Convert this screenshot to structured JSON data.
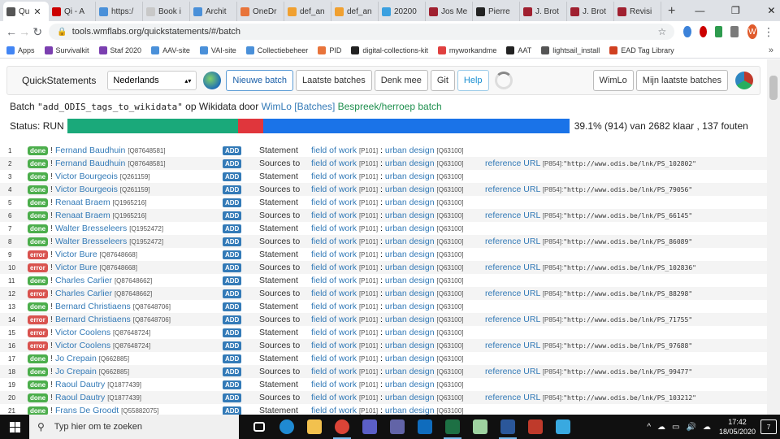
{
  "browser": {
    "tabs": [
      {
        "label": "Qu",
        "color": "#555555",
        "active": true
      },
      {
        "label": "Qi - A",
        "color": "#cc0000"
      },
      {
        "label": "https:/",
        "color": "#4a90d9"
      },
      {
        "label": "Book i",
        "color": "#c8c8c8"
      },
      {
        "label": "Archit",
        "color": "#4a90d9"
      },
      {
        "label": "OneDr",
        "color": "#e8743b"
      },
      {
        "label": "def_an",
        "color": "#f0a030"
      },
      {
        "label": "def_an",
        "color": "#f0a030"
      },
      {
        "label": "20200",
        "color": "#3aa0e0"
      },
      {
        "label": "Jos Me",
        "color": "#a02030"
      },
      {
        "label": "Pierre",
        "color": "#222222"
      },
      {
        "label": "J. Brot",
        "color": "#a02030"
      },
      {
        "label": "J. Brot",
        "color": "#a02030"
      },
      {
        "label": "Revisi",
        "color": "#a02030"
      }
    ],
    "tab_close": "✕",
    "new_tab": "+",
    "window_controls": [
      "—",
      "❐",
      "✕"
    ],
    "url": "tools.wmflabs.org/quickstatements/#/batch",
    "profile_initial": "W",
    "bookmarks": [
      {
        "label": "Apps",
        "color": "#4285f4"
      },
      {
        "label": "Survivalkit",
        "color": "#7b3fb0"
      },
      {
        "label": "Staf 2020",
        "color": "#7b3fb0"
      },
      {
        "label": "AAV-site",
        "color": "#4a90d9"
      },
      {
        "label": "VAI-site",
        "color": "#4a90d9"
      },
      {
        "label": "Collectiebeheer",
        "color": "#4a90d9"
      },
      {
        "label": "PID",
        "color": "#e8743b"
      },
      {
        "label": "digital-collections-kit",
        "color": "#222222"
      },
      {
        "label": "myworkandme",
        "color": "#e04040"
      },
      {
        "label": "AAT",
        "color": "#222222"
      },
      {
        "label": "lightsail_install",
        "color": "#555555"
      },
      {
        "label": "EAD Tag Library",
        "color": "#d04020"
      }
    ],
    "bookmarks_more": "»"
  },
  "app": {
    "brand": "QuickStatements",
    "language": "Nederlands",
    "buttons": {
      "new_batch": "Nieuwe batch",
      "last_batches": "Laatste batches",
      "think_along": "Denk mee",
      "git": "Git",
      "help": "Help",
      "user": "WimLo",
      "my_batches": "Mijn laatste batches"
    }
  },
  "batch": {
    "prefix": "Batch ",
    "name": "\"add_ODIS_tags_to_wikidata\"",
    "mid": " op Wikidata door ",
    "user": "WimLo",
    "batches_link": "[Batches]",
    "discuss_link": "Bespreek/herroep batch",
    "status_label": "Status: RUN",
    "progress_text": "39.1% (914) van 2682 klaar , 137 fouten",
    "progress_segments": [
      {
        "fraction": 0.34,
        "color": "#1aa97a"
      },
      {
        "fraction": 0.051,
        "color": "#e0363c"
      },
      {
        "fraction": 0.609,
        "color": "#1a73e8"
      }
    ]
  },
  "rows": [
    {
      "n": "1",
      "status": "done",
      "item": "Fernand Baudhuin",
      "qid": "[Q87648581]",
      "cmd": "ADD",
      "type": "Statement",
      "prop": "field of work",
      "pid": "[P101]",
      "sep": " : ",
      "value": "urban design",
      "vqid": "[Q63100]",
      "ref": "",
      "refpid": "",
      "refval": ""
    },
    {
      "n": "2",
      "status": "done",
      "item": "Fernand Baudhuin",
      "qid": "[Q87648581]",
      "cmd": "ADD",
      "type": "Sources to",
      "prop": "field of work",
      "pid": "[P101]",
      "sep": " : ",
      "value": "urban design",
      "vqid": "[Q63100]",
      "ref": "reference URL",
      "refpid": "[P854]:",
      "refval": "\"http://www.odis.be/lnk/PS_102802\""
    },
    {
      "n": "3",
      "status": "done",
      "item": "Victor Bourgeois",
      "qid": "[Q261159]",
      "cmd": "ADD",
      "type": "Statement",
      "prop": "field of work",
      "pid": "[P101]",
      "sep": " : ",
      "value": "urban design",
      "vqid": "[Q63100]",
      "ref": "",
      "refpid": "",
      "refval": ""
    },
    {
      "n": "4",
      "status": "done",
      "item": "Victor Bourgeois",
      "qid": "[Q261159]",
      "cmd": "ADD",
      "type": "Sources to",
      "prop": "field of work",
      "pid": "[P101]",
      "sep": " : ",
      "value": "urban design",
      "vqid": "[Q63100]",
      "ref": "reference URL",
      "refpid": "[P854]:",
      "refval": "\"http://www.odis.be/lnk/PS_79056\""
    },
    {
      "n": "5",
      "status": "done",
      "item": "Renaat Braem",
      "qid": "[Q1965216]",
      "cmd": "ADD",
      "type": "Statement",
      "prop": "field of work",
      "pid": "[P101]",
      "sep": " : ",
      "value": "urban design",
      "vqid": "[Q63100]",
      "ref": "",
      "refpid": "",
      "refval": ""
    },
    {
      "n": "6",
      "status": "done",
      "item": "Renaat Braem",
      "qid": "[Q1965216]",
      "cmd": "ADD",
      "type": "Sources to",
      "prop": "field of work",
      "pid": "[P101]",
      "sep": " : ",
      "value": "urban design",
      "vqid": "[Q63100]",
      "ref": "reference URL",
      "refpid": "[P854]:",
      "refval": "\"http://www.odis.be/lnk/PS_66145\""
    },
    {
      "n": "7",
      "status": "done",
      "item": "Walter Bresseleers",
      "qid": "[Q1952472]",
      "cmd": "ADD",
      "type": "Statement",
      "prop": "field of work",
      "pid": "[P101]",
      "sep": " : ",
      "value": "urban design",
      "vqid": "[Q63100]",
      "ref": "",
      "refpid": "",
      "refval": ""
    },
    {
      "n": "8",
      "status": "done",
      "item": "Walter Bresseleers",
      "qid": "[Q1952472]",
      "cmd": "ADD",
      "type": "Sources to",
      "prop": "field of work",
      "pid": "[P101]",
      "sep": " : ",
      "value": "urban design",
      "vqid": "[Q63100]",
      "ref": "reference URL",
      "refpid": "[P854]:",
      "refval": "\"http://www.odis.be/lnk/PS_86089\""
    },
    {
      "n": "9",
      "status": "error",
      "item": "Victor Bure",
      "qid": "[Q87648668]",
      "cmd": "ADD",
      "type": "Statement",
      "prop": "field of work",
      "pid": "[P101]",
      "sep": " : ",
      "value": "urban design",
      "vqid": "[Q63100]",
      "ref": "",
      "refpid": "",
      "refval": ""
    },
    {
      "n": "10",
      "status": "error",
      "item": "Victor Bure",
      "qid": "[Q87648668]",
      "cmd": "ADD",
      "type": "Sources to",
      "prop": "field of work",
      "pid": "[P101]",
      "sep": " : ",
      "value": "urban design",
      "vqid": "[Q63100]",
      "ref": "reference URL",
      "refpid": "[P854]:",
      "refval": "\"http://www.odis.be/lnk/PS_102836\""
    },
    {
      "n": "11",
      "status": "done",
      "item": "Charles Carlier",
      "qid": "[Q87648662]",
      "cmd": "ADD",
      "type": "Statement",
      "prop": "field of work",
      "pid": "[P101]",
      "sep": " : ",
      "value": "urban design",
      "vqid": "[Q63100]",
      "ref": "",
      "refpid": "",
      "refval": ""
    },
    {
      "n": "12",
      "status": "error",
      "item": "Charles Carlier",
      "qid": "[Q87648662]",
      "cmd": "ADD",
      "type": "Sources to",
      "prop": "field of work",
      "pid": "[P101]",
      "sep": " : ",
      "value": "urban design",
      "vqid": "[Q63100]",
      "ref": "reference URL",
      "refpid": "[P854]:",
      "refval": "\"http://www.odis.be/lnk/PS_88298\""
    },
    {
      "n": "13",
      "status": "done",
      "item": "Bernard Christiaens",
      "qid": "[Q87648706]",
      "cmd": "ADD",
      "type": "Statement",
      "prop": "field of work",
      "pid": "[P101]",
      "sep": " : ",
      "value": "urban design",
      "vqid": "[Q63100]",
      "ref": "",
      "refpid": "",
      "refval": ""
    },
    {
      "n": "14",
      "status": "error",
      "item": "Bernard Christiaens",
      "qid": "[Q87648706]",
      "cmd": "ADD",
      "type": "Sources to",
      "prop": "field of work",
      "pid": "[P101]",
      "sep": " : ",
      "value": "urban design",
      "vqid": "[Q63100]",
      "ref": "reference URL",
      "refpid": "[P854]:",
      "refval": "\"http://www.odis.be/lnk/PS_71755\""
    },
    {
      "n": "15",
      "status": "error",
      "item": "Victor Coolens",
      "qid": "[Q87648724]",
      "cmd": "ADD",
      "type": "Statement",
      "prop": "field of work",
      "pid": "[P101]",
      "sep": " : ",
      "value": "urban design",
      "vqid": "[Q63100]",
      "ref": "",
      "refpid": "",
      "refval": ""
    },
    {
      "n": "16",
      "status": "error",
      "item": "Victor Coolens",
      "qid": "[Q87648724]",
      "cmd": "ADD",
      "type": "Sources to",
      "prop": "field of work",
      "pid": "[P101]",
      "sep": " : ",
      "value": "urban design",
      "vqid": "[Q63100]",
      "ref": "reference URL",
      "refpid": "[P854]:",
      "refval": "\"http://www.odis.be/lnk/PS_97688\""
    },
    {
      "n": "17",
      "status": "done",
      "item": "Jo Crepain",
      "qid": "[Q662885]",
      "cmd": "ADD",
      "type": "Statement",
      "prop": "field of work",
      "pid": "[P101]",
      "sep": " : ",
      "value": "urban design",
      "vqid": "[Q63100]",
      "ref": "",
      "refpid": "",
      "refval": ""
    },
    {
      "n": "18",
      "status": "done",
      "item": "Jo Crepain",
      "qid": "[Q662885]",
      "cmd": "ADD",
      "type": "Sources to",
      "prop": "field of work",
      "pid": "[P101]",
      "sep": " : ",
      "value": "urban design",
      "vqid": "[Q63100]",
      "ref": "reference URL",
      "refpid": "[P854]:",
      "refval": "\"http://www.odis.be/lnk/PS_99477\""
    },
    {
      "n": "19",
      "status": "done",
      "item": "Raoul Dautry",
      "qid": "[Q1877439]",
      "cmd": "ADD",
      "type": "Statement",
      "prop": "field of work",
      "pid": "[P101]",
      "sep": " : ",
      "value": "urban design",
      "vqid": "[Q63100]",
      "ref": "",
      "refpid": "",
      "refval": ""
    },
    {
      "n": "20",
      "status": "done",
      "item": "Raoul Dautry",
      "qid": "[Q1877439]",
      "cmd": "ADD",
      "type": "Sources to",
      "prop": "field of work",
      "pid": "[P101]",
      "sep": " : ",
      "value": "urban design",
      "vqid": "[Q63100]",
      "ref": "reference URL",
      "refpid": "[P854]:",
      "refval": "\"http://www.odis.be/lnk/PS_103212\""
    },
    {
      "n": "21",
      "status": "done",
      "item": "Frans De Groodt",
      "qid": "[Q55882075]",
      "cmd": "ADD",
      "type": "Statement",
      "prop": "field of work",
      "pid": "[P101]",
      "sep": " : ",
      "value": "urban design",
      "vqid": "[Q63100]",
      "ref": "",
      "refpid": "",
      "refval": ""
    }
  ],
  "taskbar": {
    "search_placeholder": "Typ hier om te zoeken",
    "apps": [
      {
        "name": "task-view-icon",
        "color": "#101010"
      },
      {
        "name": "edge-icon",
        "color": "#1f8ad2"
      },
      {
        "name": "file-explorer-icon",
        "color": "#f2c14e"
      },
      {
        "name": "chrome-icon",
        "color": "#db4437",
        "active": true
      },
      {
        "name": "teams-icon",
        "color": "#5b5fc7"
      },
      {
        "name": "teams-meeting-icon",
        "color": "#6264a7"
      },
      {
        "name": "outlook-icon",
        "color": "#0f6cbd"
      },
      {
        "name": "excel-icon",
        "color": "#1d7044",
        "active": true
      },
      {
        "name": "notepad-icon",
        "color": "#9ed2a0"
      },
      {
        "name": "word-icon",
        "color": "#2b579a",
        "active": true
      },
      {
        "name": "filezilla-icon",
        "color": "#bf3a2b"
      },
      {
        "name": "diamond-app-icon",
        "color": "#39a9e0"
      }
    ],
    "tray_icons": [
      "^",
      "☁",
      "▭",
      "🔊",
      "☁"
    ],
    "time": "17:42",
    "date": "18/05/2020",
    "notifications": "7"
  }
}
